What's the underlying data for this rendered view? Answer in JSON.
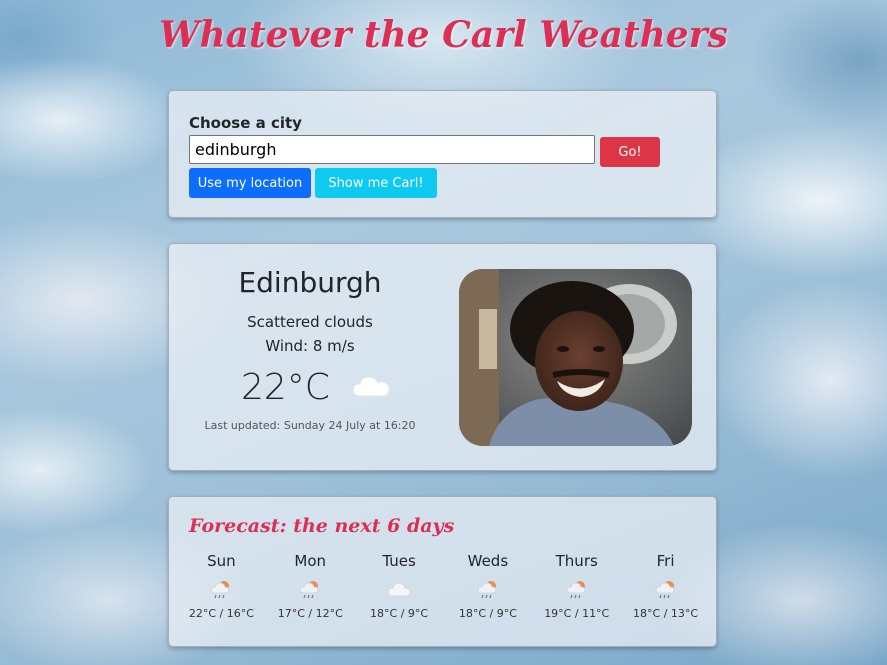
{
  "app": {
    "title": "Whatever the Carl Weathers"
  },
  "search": {
    "label": "Choose a city",
    "value": "edinburgh",
    "go_label": "Go!",
    "location_label": "Use my location",
    "carl_label": "Show me Carl!"
  },
  "current": {
    "city": "Edinburgh",
    "description": "Scattered clouds",
    "wind": "Wind: 8 m/s",
    "temperature": "22°C",
    "icon": "cloud-icon",
    "updated": "Last updated: Sunday 24 July at 16:20"
  },
  "forecast": {
    "title": "Forecast: the next 6 days",
    "days": [
      {
        "name": "Sun",
        "icon": "rain-sun-icon",
        "temps": "22°C / 16°C"
      },
      {
        "name": "Mon",
        "icon": "rain-sun-icon",
        "temps": "17°C / 12°C"
      },
      {
        "name": "Tues",
        "icon": "cloud-icon",
        "temps": "18°C / 9°C"
      },
      {
        "name": "Weds",
        "icon": "rain-sun-icon",
        "temps": "18°C / 9°C"
      },
      {
        "name": "Thurs",
        "icon": "rain-sun-icon",
        "temps": "19°C / 11°C"
      },
      {
        "name": "Fri",
        "icon": "rain-sun-icon",
        "temps": "18°C / 13°C"
      }
    ]
  },
  "colors": {
    "title": "#dc2f55",
    "go_button": "#dc3545",
    "location_button": "#0d6efd",
    "carl_button": "#0dcaf0"
  }
}
